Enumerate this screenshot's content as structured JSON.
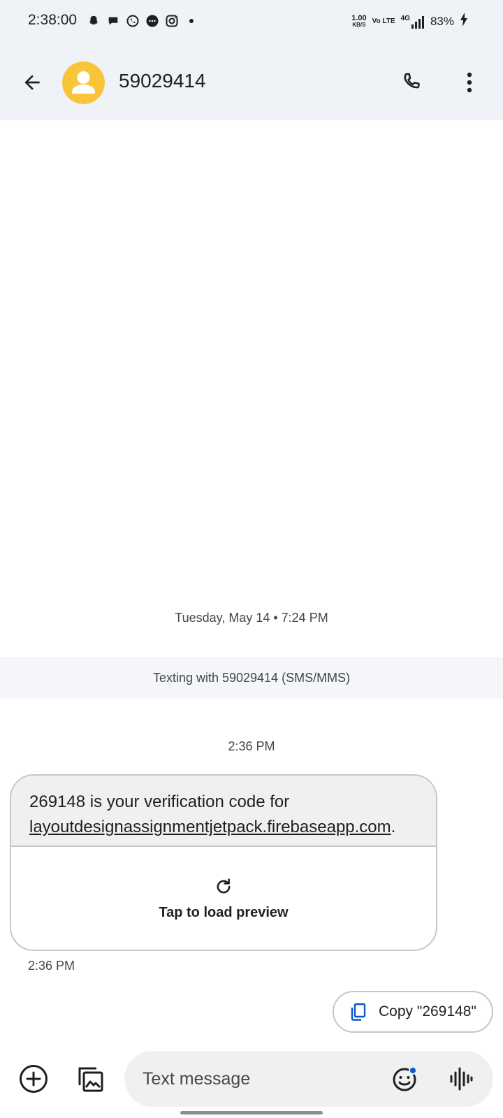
{
  "status_bar": {
    "time": "2:38:00",
    "speed_value": "1.00",
    "speed_unit": "KB/S",
    "volte": "Vo LTE",
    "network": "4G",
    "battery": "83%"
  },
  "app_bar": {
    "contact": "59029414",
    "avatar_color": "#f8c43a"
  },
  "conversation": {
    "date_divider": "Tuesday, May 14 • 7:24 PM",
    "texting_banner": "Texting with 59029414 (SMS/MMS)",
    "message_time": "2:36 PM",
    "message": {
      "text_prefix": "269148 is your verification code for ",
      "link": "layoutdesignassignmentjetpack.firebaseapp.com",
      "text_suffix": ".",
      "preview_label": "Tap to load preview",
      "sent_time": "2:36 PM"
    },
    "copy_chip": "Copy \"269148\""
  },
  "compose": {
    "placeholder": "Text message"
  },
  "icons": {
    "back": "arrow-back-icon",
    "phone": "phone-icon",
    "more": "more-vert-icon",
    "refresh": "refresh-icon",
    "copy": "copy-icon",
    "add": "add-circle-icon",
    "gallery": "gallery-icon",
    "emoji": "emoji-icon",
    "voice": "voice-icon"
  },
  "colors": {
    "accent": "#0b57d0",
    "header_bg": "#eff2f7"
  }
}
